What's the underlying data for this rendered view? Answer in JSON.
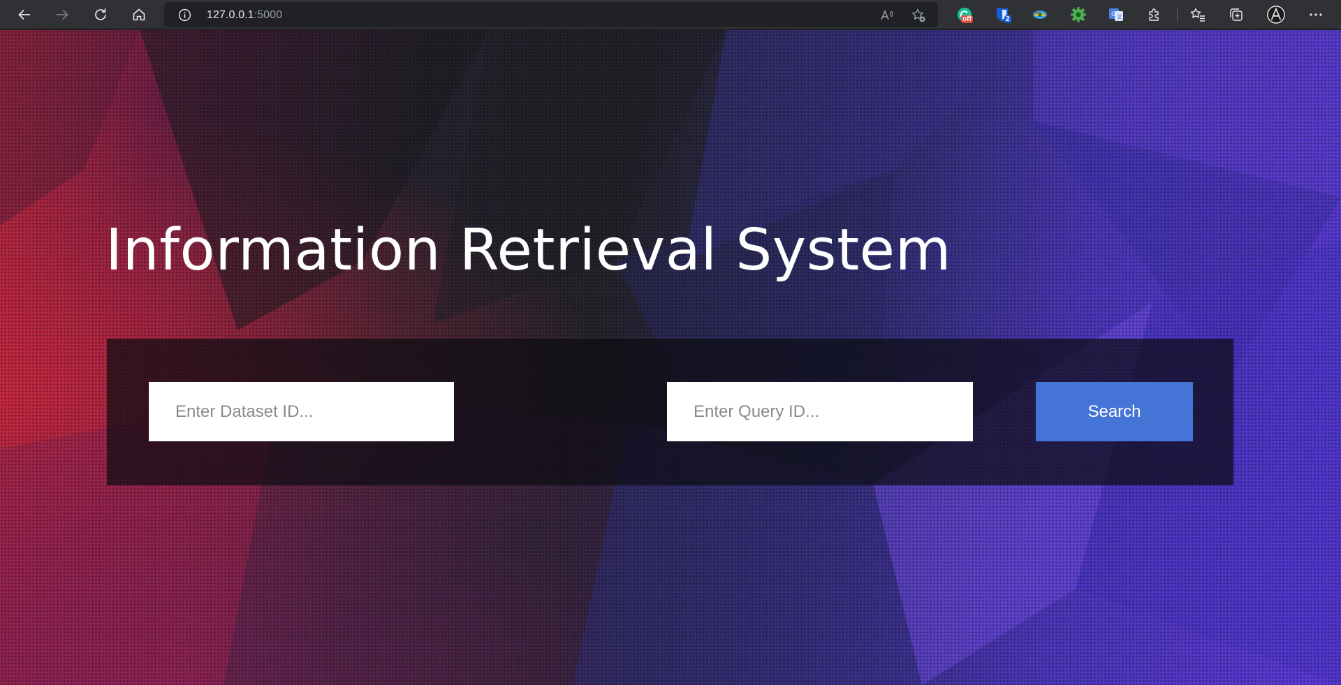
{
  "browser": {
    "url_host": "127.0.0.1",
    "url_port": ":5000",
    "icons": {
      "back": "back-arrow-icon",
      "forward": "forward-arrow-icon",
      "refresh": "refresh-icon",
      "home": "home-icon",
      "site_info": "info-icon",
      "read_aloud": "read-aloud-icon",
      "add_favorite": "add-favorite-icon",
      "extensions": "puzzle-icon",
      "favorites": "favorites-icon",
      "collections": "collections-icon",
      "profile": "profile-icon",
      "menu": "more-icon"
    },
    "extensions": [
      {
        "name": "grammarly-extension",
        "badge": "off",
        "badge_color": "#e24a3b",
        "color": "#15c39a"
      },
      {
        "name": "bitwarden-extension",
        "badge": "2",
        "badge_color": "#175ddc",
        "color": "#175ddc"
      },
      {
        "name": "color-extension",
        "badge": "",
        "color": "#3aa0e0"
      },
      {
        "name": "gear-extension",
        "badge": "",
        "color": "#4caf50"
      },
      {
        "name": "translate-extension",
        "badge": "",
        "color": "#4a7fe0"
      }
    ]
  },
  "page": {
    "title": "Information Retrieval System",
    "dataset_placeholder": "Enter Dataset ID...",
    "query_placeholder": "Enter Query ID...",
    "search_label": "Search",
    "colors": {
      "button": "#4474d6",
      "panel": "rgba(12,12,20,0.72)",
      "bg_red": "#b0263f",
      "bg_purple": "#5b3ad6"
    }
  }
}
